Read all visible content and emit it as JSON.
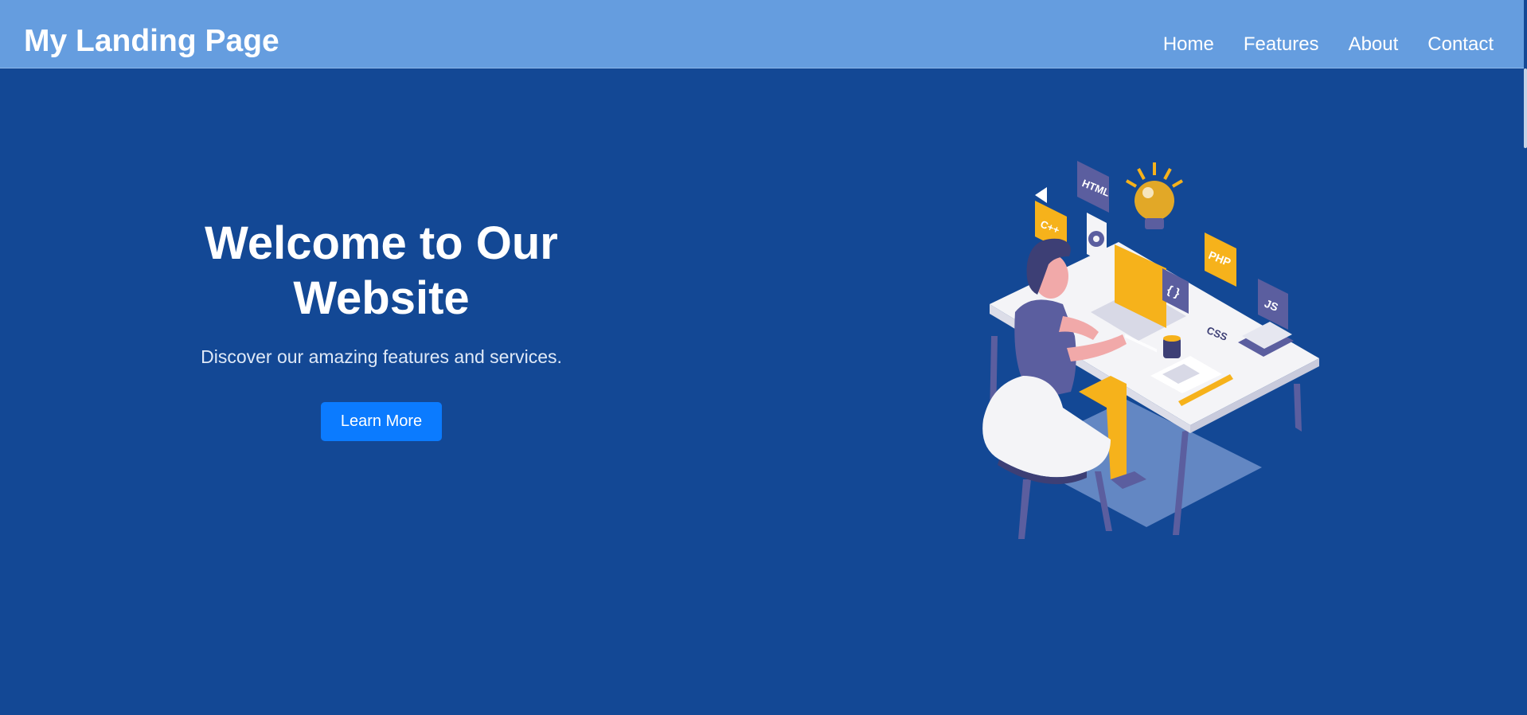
{
  "header": {
    "brand": "My Landing Page",
    "nav": [
      {
        "label": "Home"
      },
      {
        "label": "Features"
      },
      {
        "label": "About"
      },
      {
        "label": "Contact"
      }
    ]
  },
  "hero": {
    "title": "Welcome to Our Website",
    "subtitle": "Discover our amazing features and services.",
    "cta_label": "Learn More",
    "illustration_tags": [
      "HTML",
      "C++",
      "PHP",
      "JS",
      "CSS",
      "{ }"
    ]
  },
  "colors": {
    "nav_bg": "#659ddf",
    "hero_bg": "#134895",
    "cta_bg": "#0b7bff",
    "accent_yellow": "#f6b21b",
    "accent_purple": "#5b5e9f"
  }
}
